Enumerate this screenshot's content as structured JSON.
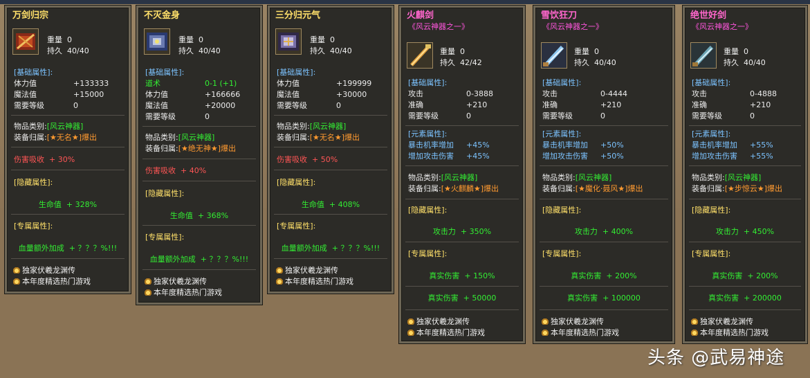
{
  "cards": [
    {
      "title": "万剑归宗",
      "weight": "重量  0",
      "durability": "持久  40/40",
      "basic_label": "[基础属性]:",
      "basic": [
        [
          "体力值",
          "+133333"
        ],
        [
          "魔法值",
          "+15000"
        ],
        [
          "需要等级",
          "0"
        ]
      ],
      "category_label": "物品类别:",
      "category_value": "[风云神器]",
      "owner_label": "装备归属:",
      "owner_value": "[★无名★]爆出",
      "special_line": "伤害吸收  + 30%",
      "hidden_label": "[隐藏属性]:",
      "hidden_value": "生命值  + 328%",
      "exclusive_label": "[专属属性]:",
      "exclusive_value": "血量额外加成  + ？？？%!!!",
      "foot1": "独家伏羲龙渊传",
      "foot2": "本年度精选热门游戏"
    },
    {
      "title": "不灭金身",
      "weight": "重量  0",
      "durability": "持久  40/40",
      "basic_label": "[基础属性]:",
      "basic_green": [
        "道术",
        "0-1 (+1)"
      ],
      "basic": [
        [
          "体力值",
          "+166666"
        ],
        [
          "魔法值",
          "+20000"
        ],
        [
          "需要等级",
          "0"
        ]
      ],
      "category_label": "物品类别:",
      "category_value": "[风云神器]",
      "owner_label": "装备归属:",
      "owner_value": "[★绝无神★]爆出",
      "special_line": "伤害吸收  + 40%",
      "hidden_label": "[隐藏属性]:",
      "hidden_value": "生命值  + 368%",
      "exclusive_label": "[专属属性]:",
      "exclusive_value": "血量额外加成  + ？？？%!!!",
      "foot1": "独家伏羲龙渊传",
      "foot2": "本年度精选热门游戏"
    },
    {
      "title": "三分归元气",
      "weight": "重量  0",
      "durability": "持久  40/40",
      "basic_label": "[基础属性]:",
      "basic": [
        [
          "体力值",
          "+199999"
        ],
        [
          "魔法值",
          "+30000"
        ],
        [
          "需要等级",
          "0"
        ]
      ],
      "category_label": "物品类别:",
      "category_value": "[风云神器]",
      "owner_label": "装备归属:",
      "owner_value": "[★无名★]爆出",
      "special_line": "伤害吸收  + 50%",
      "hidden_label": "[隐藏属性]:",
      "hidden_value": "生命值  + 408%",
      "exclusive_label": "[专属属性]:",
      "exclusive_value": "血量额外加成  + ？？？%!!!",
      "foot1": "独家伏羲龙渊传",
      "foot2": "本年度精选热门游戏"
    },
    {
      "title": "火麒剑",
      "subtitle": "《风云神器之一》",
      "weight": "重量  0",
      "durability": "持久  42/42",
      "basic_label": "[基础属性]:",
      "basic": [
        [
          "攻击",
          "0-3888"
        ],
        [
          "准确",
          "+210"
        ],
        [
          "需要等级",
          "0"
        ]
      ],
      "element_label": "[元素属性]:",
      "element": [
        [
          "暴击机率增加",
          "+45%"
        ],
        [
          "增加攻击伤害",
          "+45%"
        ]
      ],
      "category_label": "物品类别:",
      "category_value": "[风云神器]",
      "owner_label": "装备归属:",
      "owner_value": "[★火麒麟★]爆出",
      "hidden_label": "[隐藏属性]:",
      "hidden_value": "攻击力  + 350%",
      "exclusive_label": "[专属属性]:",
      "exclusive_values": [
        "真实伤害  + 150%",
        "真实伤害  + 50000"
      ],
      "foot1": "独家伏羲龙渊传",
      "foot2": "本年度精选热门游戏"
    },
    {
      "title": "雪饮狂刀",
      "subtitle": "《风云神器之一》",
      "weight": "重量  0",
      "durability": "持久  40/40",
      "basic_label": "[基础属性]:",
      "basic": [
        [
          "攻击",
          "0-4444"
        ],
        [
          "准确",
          "+210"
        ],
        [
          "需要等级",
          "0"
        ]
      ],
      "element_label": "[元素属性]:",
      "element": [
        [
          "暴击机率增加",
          "+50%"
        ],
        [
          "增加攻击伤害",
          "+50%"
        ]
      ],
      "category_label": "物品类别:",
      "category_value": "[风云神器]",
      "owner_label": "装备归属:",
      "owner_value": "[★魔化·聂风★]爆出",
      "hidden_label": "[隐藏属性]:",
      "hidden_value": "攻击力  + 400%",
      "exclusive_label": "[专属属性]:",
      "exclusive_values": [
        "真实伤害  + 200%",
        "真实伤害  + 100000"
      ],
      "foot1": "独家伏羲龙渊传",
      "foot2": "本年度精选热门游戏"
    },
    {
      "title": "绝世好剑",
      "subtitle": "《风云神器之一》",
      "weight": "重量  0",
      "durability": "持久  40/40",
      "basic_label": "[基础属性]:",
      "basic": [
        [
          "攻击",
          "0-4888"
        ],
        [
          "准确",
          "+210"
        ],
        [
          "需要等级",
          "0"
        ]
      ],
      "element_label": "[元素属性]:",
      "element": [
        [
          "暴击机率增加",
          "+55%"
        ],
        [
          "增加攻击伤害",
          "+55%"
        ]
      ],
      "category_label": "物品类别:",
      "category_value": "[风云神器]",
      "owner_label": "装备归属:",
      "owner_value": "[★步惊云★]爆出",
      "hidden_label": "[隐藏属性]:",
      "hidden_value": "攻击力  + 450%",
      "exclusive_label": "[专属属性]:",
      "exclusive_values": [
        "真实伤害  + 200%",
        "真实伤害  + 200000"
      ],
      "foot1": "独家伏羲龙渊传",
      "foot2": "本年度精选热门游戏"
    }
  ],
  "watermark": "头条 @武易神途",
  "colors": {
    "panel_bg": "#2c2b27",
    "panel_border": "#6d6656",
    "label_blue": "#7cc3ff",
    "green": "#33ee33",
    "orange": "#ff9a30",
    "red": "#ff5555",
    "title_yellow": "#ffe06a",
    "title_pink": "#ff66cc"
  }
}
